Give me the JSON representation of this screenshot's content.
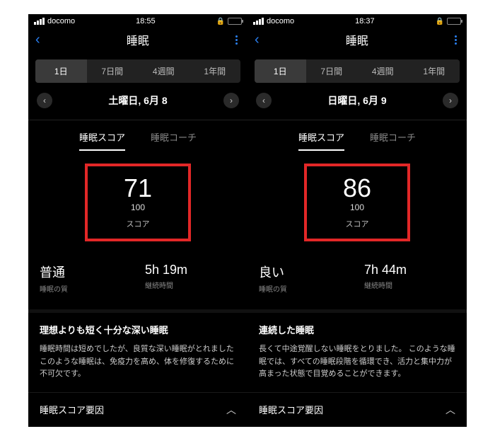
{
  "screens": [
    {
      "status": {
        "carrier": "docomo",
        "time": "18:55"
      },
      "nav": {
        "title": "睡眠"
      },
      "segments": [
        "1日",
        "7日間",
        "4週間",
        "1年間"
      ],
      "date": "土曜日, 6月 8",
      "tabs": {
        "score": "睡眠スコア",
        "coach": "睡眠コーチ"
      },
      "score": {
        "value": "71",
        "max": "100",
        "label": "スコア"
      },
      "metrics": {
        "quality_val": "普通",
        "quality_sub": "睡眠の質",
        "duration_val": "5h 19m",
        "duration_sub": "継続時間"
      },
      "summary": {
        "heading": "理想よりも短く十分な深い睡眠",
        "body": "睡眠時間は短めでしたが、良質な深い睡眠がとれました このような睡眠は、免疫力を高め、体を修復するために不可欠です。"
      },
      "factor_label": "睡眠スコア要因"
    },
    {
      "status": {
        "carrier": "docomo",
        "time": "18:37"
      },
      "nav": {
        "title": "睡眠"
      },
      "segments": [
        "1日",
        "7日間",
        "4週間",
        "1年間"
      ],
      "date": "日曜日, 6月 9",
      "tabs": {
        "score": "睡眠スコア",
        "coach": "睡眠コーチ"
      },
      "score": {
        "value": "86",
        "max": "100",
        "label": "スコア"
      },
      "metrics": {
        "quality_val": "良い",
        "quality_sub": "睡眠の質",
        "duration_val": "7h 44m",
        "duration_sub": "継続時間"
      },
      "summary": {
        "heading": "連続した睡眠",
        "body": "長くて中途覚醒しない睡眠をとりました。 このような睡眠では、すべての睡眠段階を循環でき、活力と集中力が高まった状態で目覚めることができます。"
      },
      "factor_label": "睡眠スコア要因"
    }
  ]
}
